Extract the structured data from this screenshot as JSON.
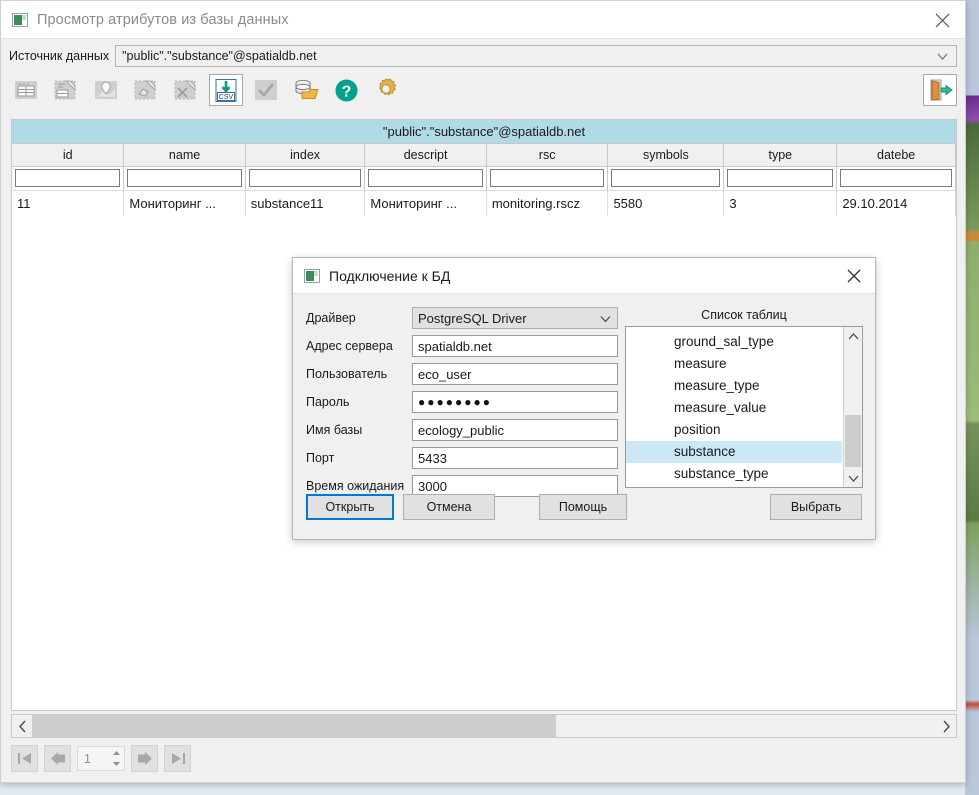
{
  "window": {
    "title": "Просмотр атрибутов из базы данных",
    "close_label": "×",
    "icon": "app-window-icon"
  },
  "source": {
    "label": "Источник данных",
    "value": "\"public\".\"substance\"@spatialdb.net",
    "caret": "chevron-down-icon"
  },
  "toolbar": {
    "buttons": [
      {
        "name": "table-view-icon",
        "enabled": false
      },
      {
        "name": "table-select-icon",
        "enabled": false
      },
      {
        "name": "map-marker-icon",
        "enabled": false
      },
      {
        "name": "shape-select-icon",
        "enabled": false
      },
      {
        "name": "shape-delete-icon",
        "enabled": false
      },
      {
        "name": "csv-export-icon",
        "enabled": true
      },
      {
        "name": "check-apply-icon",
        "enabled": false
      },
      {
        "name": "database-open-icon",
        "enabled": true
      },
      {
        "name": "help-icon",
        "enabled": true
      },
      {
        "name": "settings-gear-icon",
        "enabled": true
      }
    ],
    "exit": {
      "name": "exit-door-icon",
      "enabled": true
    }
  },
  "table": {
    "caption": "\"public\".\"substance\"@spatialdb.net",
    "columns": [
      "id",
      "name",
      "index",
      "descript",
      "rsc",
      "symbols",
      "type",
      "datebe"
    ],
    "filters": [
      "",
      "",
      "",
      "",
      "",
      "",
      "",
      ""
    ],
    "rows": [
      [
        "11",
        "Мониторинг ...",
        "substance11",
        "Мониторинг ...",
        "monitoring.rscz",
        "5580",
        "3",
        "29.10.2014"
      ]
    ]
  },
  "hscroll": {
    "left_arrow": "chevron-left-icon",
    "right_arrow": "chevron-right-icon",
    "thumb_percent": 58
  },
  "pager": {
    "first": "first-page-icon",
    "prev": "prev-page-icon",
    "page_value": "1",
    "next": "next-page-icon",
    "last": "last-page-icon",
    "spin_up": "spin-up-icon",
    "spin_down": "spin-down-icon"
  },
  "dialog": {
    "title": "Подключение к БД",
    "close_label": "×",
    "icon": "app-window-icon",
    "fields": [
      {
        "label": "Драйвер",
        "value": "PostgreSQL Driver",
        "type": "combo"
      },
      {
        "label": "Адрес сервера",
        "value": "spatialdb.net",
        "type": "text"
      },
      {
        "label": "Пользователь",
        "value": "eco_user",
        "type": "text"
      },
      {
        "label": "Пароль",
        "value": "●●●●●●●●",
        "type": "password"
      },
      {
        "label": "Имя базы",
        "value": "ecology_public",
        "type": "text"
      },
      {
        "label": "Порт",
        "value": "5433",
        "type": "text"
      },
      {
        "label": "Время ожидания",
        "value": "3000",
        "type": "text"
      }
    ],
    "tables": {
      "title": "Список таблиц",
      "items": [
        {
          "label": "ground_sal_type",
          "selected": false
        },
        {
          "label": "measure",
          "selected": false
        },
        {
          "label": "measure_type",
          "selected": false
        },
        {
          "label": "measure_value",
          "selected": false
        },
        {
          "label": "position",
          "selected": false
        },
        {
          "label": "substance",
          "selected": true
        },
        {
          "label": "substance_type",
          "selected": false
        }
      ],
      "scroll_up": "chevron-up-icon",
      "scroll_down": "chevron-down-icon"
    },
    "buttons": {
      "open": "Открыть",
      "cancel": "Отмена",
      "help": "Помощь",
      "select": "Выбрать"
    }
  },
  "colors": {
    "caption_bg": "#b0dae6",
    "selection_bg": "#cce8f7",
    "focus_border": "#0078d7",
    "help_green": "#00a08a"
  }
}
